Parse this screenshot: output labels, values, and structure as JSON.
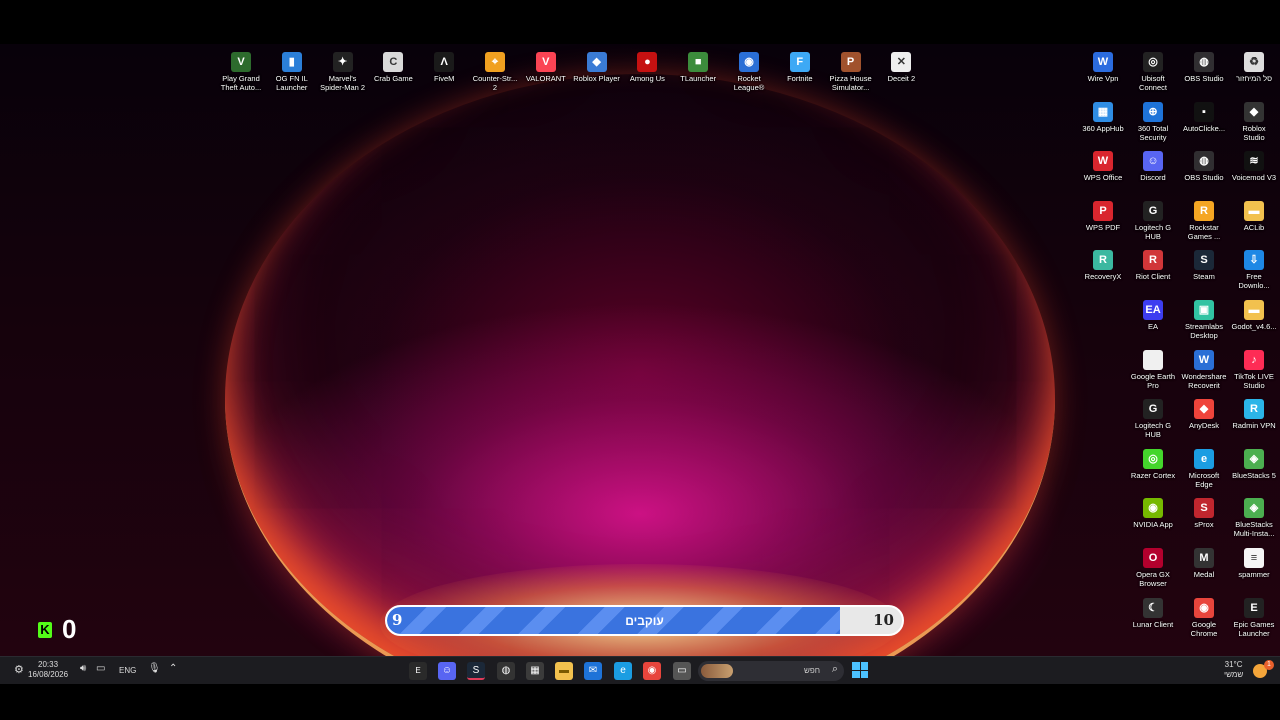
{
  "desktop_icons_top": [
    {
      "label": "Play Grand\nTheft Auto...",
      "icon": "gta-icon",
      "color": "#2d6b2d",
      "glyph": "V"
    },
    {
      "label": "OG FN IL\nLauncher",
      "icon": "og-fn-icon",
      "color": "#2b7fd8",
      "glyph": "▮"
    },
    {
      "label": "Marvel's\nSpider-Man 2",
      "icon": "spiderman-icon",
      "color": "#222222",
      "glyph": "✦"
    },
    {
      "label": "Crab Game",
      "icon": "crab-game-icon",
      "color": "#d9d9d9",
      "glyph": "C"
    },
    {
      "label": "FiveM",
      "icon": "fivem-icon",
      "color": "#1a1a1a",
      "glyph": "Λ"
    },
    {
      "label": "Counter-Str...\n2",
      "icon": "counter-strike-icon",
      "color": "#f0a020",
      "glyph": "⌖"
    },
    {
      "label": "VALORANT",
      "icon": "valorant-icon",
      "color": "#fa4454",
      "glyph": "V"
    },
    {
      "label": "Roblox Player",
      "icon": "roblox-player-icon",
      "color": "#3a7bd5",
      "glyph": "◆"
    },
    {
      "label": "Among Us",
      "icon": "among-us-icon",
      "color": "#c51111",
      "glyph": "●"
    },
    {
      "label": "TLauncher",
      "icon": "tlauncher-icon",
      "color": "#3c8c3c",
      "glyph": "■"
    },
    {
      "label": "Rocket\nLeague®",
      "icon": "rocket-league-icon",
      "color": "#2a6fd6",
      "glyph": "◉"
    },
    {
      "label": "Fortnite",
      "icon": "fortnite-icon",
      "color": "#3da9f5",
      "glyph": "F"
    },
    {
      "label": "Pizza House\nSimulator...",
      "icon": "pizza-house-icon",
      "color": "#a0522d",
      "glyph": "P"
    },
    {
      "label": "Deceit 2",
      "icon": "deceit-icon",
      "color": "#eeeeee",
      "glyph": "✕"
    }
  ],
  "desktop_icons_right": [
    [
      {
        "label": "Wire Vpn",
        "icon": "wire-vpn-icon",
        "color": "#2b6cdf",
        "glyph": "W"
      },
      {
        "label": "360 AppHub",
        "icon": "360-apphub-icon",
        "color": "#2f8de4",
        "glyph": "▦"
      },
      {
        "label": "WPS Office",
        "icon": "wps-office-icon",
        "color": "#d9262e",
        "glyph": "W"
      },
      {
        "label": "WPS PDF",
        "icon": "wps-pdf-icon",
        "color": "#d9262e",
        "glyph": "P"
      },
      {
        "label": "RecoveryX",
        "icon": "recoveryx-icon",
        "color": "#3bb8a0",
        "glyph": "R"
      }
    ],
    [
      {
        "label": "Ubisoft\nConnect",
        "icon": "ubisoft-connect-icon",
        "color": "#222222",
        "glyph": "◎"
      },
      {
        "label": "360 Total\nSecurity",
        "icon": "360-total-security-icon",
        "color": "#1e73d8",
        "glyph": "⊕"
      },
      {
        "label": "Discord",
        "icon": "discord-icon",
        "color": "#5865f2",
        "glyph": "☺"
      },
      {
        "label": "Logitech G\nHUB",
        "icon": "logitech-ghub-icon",
        "color": "#222222",
        "glyph": "G"
      },
      {
        "label": "Riot Client",
        "icon": "riot-client-icon",
        "color": "#d13639",
        "glyph": "R"
      },
      {
        "label": "EA",
        "icon": "ea-icon",
        "color": "#3d3df0",
        "glyph": "EA"
      },
      {
        "label": "Google Earth\nPro",
        "icon": "google-earth-icon",
        "color": "#f0f0f0",
        "glyph": " "
      },
      {
        "label": "Logitech G\nHUB",
        "icon": "logitech-ghub-2-icon",
        "color": "#222222",
        "glyph": "G"
      },
      {
        "label": "Razer Cortex",
        "icon": "razer-cortex-icon",
        "color": "#44d62c",
        "glyph": "◎"
      },
      {
        "label": "NVIDIA App",
        "icon": "nvidia-app-icon",
        "color": "#76b900",
        "glyph": "◉"
      },
      {
        "label": "Opera GX\nBrowser",
        "icon": "opera-gx-icon",
        "color": "#b3002d",
        "glyph": "O"
      },
      {
        "label": "Lunar Client",
        "icon": "lunar-client-icon",
        "color": "#333333",
        "glyph": "☾"
      }
    ],
    [
      {
        "label": "OBS Studio",
        "icon": "obs-studio-icon",
        "color": "#302e31",
        "glyph": "◍"
      },
      {
        "label": "AutoClicke...",
        "icon": "autoclicker-icon",
        "color": "#111111",
        "glyph": "▪"
      },
      {
        "label": "OBS Studio",
        "icon": "obs-studio-2-icon",
        "color": "#302e31",
        "glyph": "◍"
      },
      {
        "label": "Rockstar\nGames ...",
        "icon": "rockstar-games-icon",
        "color": "#f5a623",
        "glyph": "R"
      },
      {
        "label": "Steam",
        "icon": "steam-icon",
        "color": "#1b2838",
        "glyph": "S"
      },
      {
        "label": "Streamlabs\nDesktop",
        "icon": "streamlabs-icon",
        "color": "#31c3a2",
        "glyph": "▣"
      },
      {
        "label": "Wondershare\nRecoverit",
        "icon": "recoverit-icon",
        "color": "#2a6fd6",
        "glyph": "W"
      },
      {
        "label": "AnyDesk",
        "icon": "anydesk-icon",
        "color": "#ef443b",
        "glyph": "◆"
      },
      {
        "label": "Microsoft\nEdge",
        "icon": "edge-icon",
        "color": "#1b9de2",
        "glyph": "e"
      },
      {
        "label": "sProx",
        "icon": "sprox-icon",
        "color": "#c0262e",
        "glyph": "S"
      },
      {
        "label": "Medal",
        "icon": "medal-icon",
        "color": "#333333",
        "glyph": "M"
      },
      {
        "label": "Google\nChrome",
        "icon": "chrome-icon",
        "color": "#e8453c",
        "glyph": "◉"
      }
    ],
    [
      {
        "label": "סל המיחזור",
        "icon": "recycle-bin-icon",
        "color": "#dddddd",
        "glyph": "♻"
      },
      {
        "label": "Roblox\nStudio",
        "icon": "roblox-studio-icon",
        "color": "#333333",
        "glyph": "◆"
      },
      {
        "label": "Voicemod V3",
        "icon": "voicemod-icon",
        "color": "#111111",
        "glyph": "≋"
      },
      {
        "label": "ACLib",
        "icon": "aclib-folder-icon",
        "color": "#f2c14e",
        "glyph": "▬"
      },
      {
        "label": "Free\nDownlo...",
        "icon": "free-download-icon",
        "color": "#1e88e5",
        "glyph": "⇩"
      },
      {
        "label": "Godot_v4.6...",
        "icon": "godot-folder-icon",
        "color": "#f2c14e",
        "glyph": "▬"
      },
      {
        "label": "TikTok LIVE\nStudio",
        "icon": "tiktok-live-icon",
        "color": "#fe2c55",
        "glyph": "♪"
      },
      {
        "label": "Radmin VPN",
        "icon": "radmin-vpn-icon",
        "color": "#2bb5e8",
        "glyph": "R"
      },
      {
        "label": "BlueStacks 5",
        "icon": "bluestacks-icon",
        "color": "#4caf50",
        "glyph": "◈"
      },
      {
        "label": "BlueStacks\nMulti-Insta...",
        "icon": "bluestacks-multi-icon",
        "color": "#4caf50",
        "glyph": "◈"
      },
      {
        "label": "spammer",
        "icon": "text-file-icon",
        "color": "#f5f5f5",
        "glyph": "≡"
      },
      {
        "label": "Epic Games\nLauncher",
        "icon": "epic-games-icon",
        "color": "#222222",
        "glyph": "E"
      }
    ]
  ],
  "overlay": {
    "progress_label": "עוקבים",
    "level_left": "9",
    "level_right": "10",
    "progress_fraction": 0.88,
    "kick_logo": "K",
    "kick_count": "0"
  },
  "taskbar": {
    "time": "20:33",
    "date": "16/08/2026",
    "lang": "ENG",
    "search_placeholder": "חפש",
    "weather_temp": "31°C",
    "weather_text": "שמשי",
    "notification_count": "1"
  }
}
